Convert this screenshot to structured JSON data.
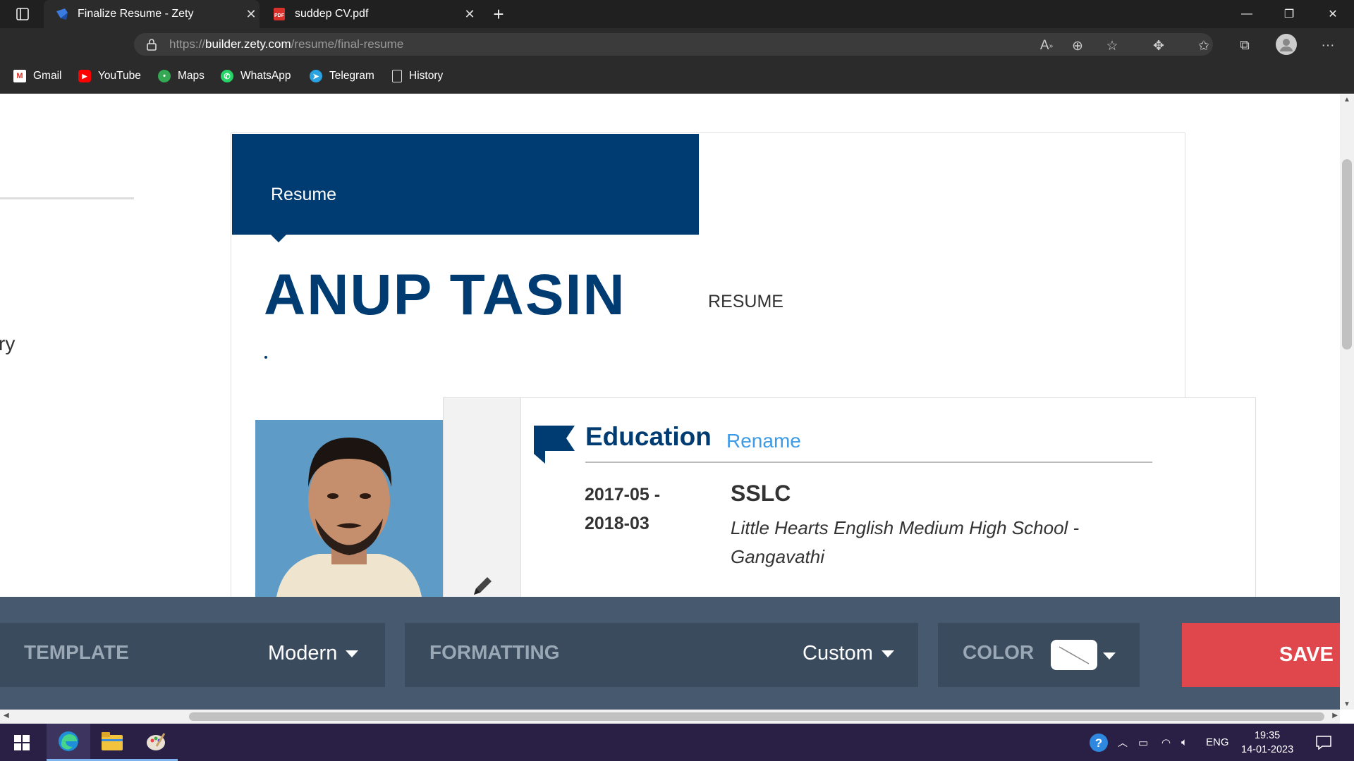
{
  "browser": {
    "tabs": [
      {
        "title": "Finalize Resume - Zety",
        "active": true
      },
      {
        "title": "suddep CV.pdf",
        "active": false
      }
    ],
    "url_scheme": "https://",
    "url_host": "builder.zety.com",
    "url_path": "/resume/final-resume",
    "bookmarks": [
      {
        "label": "Gmail",
        "icon": "gmail-icon"
      },
      {
        "label": "YouTube",
        "icon": "youtube-icon"
      },
      {
        "label": "Maps",
        "icon": "maps-icon"
      },
      {
        "label": "WhatsApp",
        "icon": "whatsapp-icon"
      },
      {
        "label": "Telegram",
        "icon": "telegram-icon"
      },
      {
        "label": "History",
        "icon": "page-icon"
      }
    ]
  },
  "page": {
    "left_fragment": "ry",
    "resume": {
      "header_label": "Resume",
      "name": "ANUP TASIN",
      "tag": "RESUME",
      "section": {
        "title": "Education",
        "rename": "Rename",
        "entries": [
          {
            "date_start": "2017-05 -",
            "date_end": "2018-03",
            "degree": "SSLC",
            "school": "Little Hearts English Medium High School - Gangavathi"
          }
        ]
      }
    }
  },
  "toolbar": {
    "template_label": "TEMPLATE",
    "template_value": "Modern",
    "formatting_label": "FORMATTING",
    "formatting_value": "Custom",
    "color_label": "COLOR",
    "save_label": "SAVE &"
  },
  "taskbar": {
    "lang": "ENG",
    "time": "19:35",
    "date": "14-01-2023"
  },
  "colors": {
    "resume_blue": "#003c71",
    "rename_blue": "#3d9ae6",
    "toolbar_bg": "#46596e",
    "save_red": "#e0474c"
  }
}
